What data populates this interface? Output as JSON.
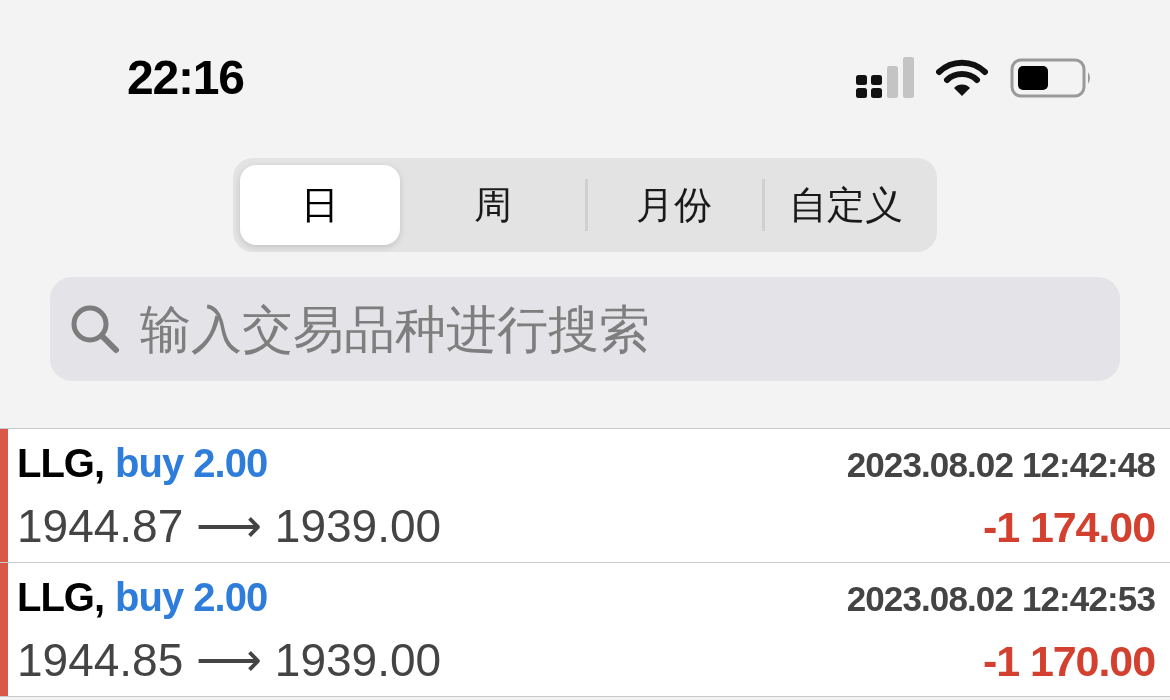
{
  "status_bar": {
    "time": "22:16"
  },
  "segments": [
    {
      "label": "日",
      "selected": true
    },
    {
      "label": "周",
      "selected": false
    },
    {
      "label": "月份",
      "selected": false
    },
    {
      "label": "自定义",
      "selected": false
    }
  ],
  "search": {
    "placeholder": "输入交易品种进行搜索"
  },
  "trades": [
    {
      "symbol": "LLG,",
      "side": "buy 2.00",
      "time": "2023.08.02 12:42:48",
      "prices": "1944.87 ⟶ 1939.00",
      "profit": "-1 174.00",
      "loss": true
    },
    {
      "symbol": "LLG,",
      "side": "buy 2.00",
      "time": "2023.08.02 12:42:53",
      "prices": "1944.85 ⟶ 1939.00",
      "profit": "-1 170.00",
      "loss": true
    }
  ]
}
